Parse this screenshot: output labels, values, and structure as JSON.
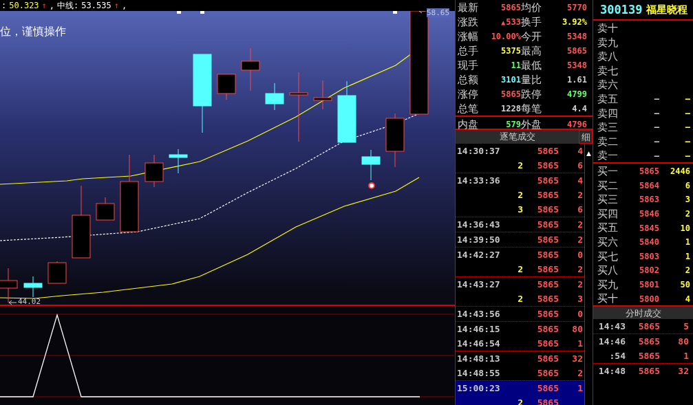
{
  "indicators": [
    {
      "label": ":",
      "value": "50.323",
      "arrow": "↑",
      "separator": ",",
      "color": "#ffff33"
    },
    {
      "label": "中线:",
      "value": "53.535",
      "arrow": "↑",
      "separator": ",",
      "color": "#ffffff"
    }
  ],
  "chart": {
    "banner": "位，谨慎操作",
    "high_label": "58.65",
    "low_label": "44.02"
  },
  "quote": [
    {
      "left": {
        "label": "最新",
        "value": "5865",
        "color": "#ff5555"
      },
      "right": {
        "label": "均价",
        "value": "5770",
        "color": "#ff5555"
      }
    },
    {
      "left": {
        "label": "涨跌",
        "icon": "▲",
        "value": "533",
        "color": "#ff5555"
      },
      "right": {
        "label": "换手",
        "value": "3.92%",
        "color": "#ffff33"
      }
    },
    {
      "left": {
        "label": "涨幅",
        "value": "10.00%",
        "color": "#ff5555"
      },
      "right": {
        "label": "今开",
        "value": "5348",
        "color": "#ff5555"
      }
    },
    {
      "left": {
        "label": "总手",
        "value": "5375",
        "color": "#ffff33"
      },
      "right": {
        "label": "最高",
        "value": "5865",
        "color": "#ff5555"
      }
    },
    {
      "left": {
        "label": "现手",
        "value": "11",
        "color": "#66ff66"
      },
      "right": {
        "label": "最低",
        "value": "5348",
        "color": "#ff5555"
      }
    },
    {
      "left": {
        "label": "总额",
        "value": "3101",
        "color": "#66ffff"
      },
      "right": {
        "label": "量比",
        "value": "1.61",
        "color": "#d0d0d0"
      }
    },
    {
      "left": {
        "label": "涨停",
        "value": "5865",
        "color": "#ff5555"
      },
      "right": {
        "label": "跌停",
        "value": "4799",
        "color": "#66ff66"
      }
    },
    {
      "left": {
        "label": "总笔",
        "value": "1228",
        "color": "#d0d0d0"
      },
      "right": {
        "label": "每笔",
        "value": "4.4",
        "color": "#d0d0d0"
      }
    }
  ],
  "volume_split": {
    "left": {
      "label": "内盘",
      "value": "579",
      "color": "#66ff66"
    },
    "right": {
      "label": "外盘",
      "value": "4796",
      "color": "#ff5555"
    }
  },
  "ticks": {
    "title": "逐笔成交",
    "detail_button": "细",
    "scroll_up": "▲",
    "groups": [
      {
        "selected": false,
        "rows": [
          {
            "time": "14:30:37",
            "price": "5865",
            "volume": "4"
          },
          {
            "count": "2",
            "price": "5865",
            "volume": "6"
          }
        ]
      },
      {
        "selected": false,
        "rows": [
          {
            "time": "14:33:36",
            "price": "5865",
            "volume": "4"
          },
          {
            "count": "2",
            "price": "5865",
            "volume": "2"
          },
          {
            "count": "3",
            "price": "5865",
            "volume": "6"
          }
        ]
      },
      {
        "selected": false,
        "rows": [
          {
            "time": "14:36:43",
            "price": "5865",
            "volume": "2"
          }
        ]
      },
      {
        "selected": false,
        "rows": [
          {
            "time": "14:39:50",
            "price": "5865",
            "volume": "2"
          }
        ]
      },
      {
        "selected": false,
        "rows": [
          {
            "time": "14:42:27",
            "price": "5865",
            "volume": "0"
          },
          {
            "count": "2",
            "price": "5865",
            "volume": "2"
          }
        ]
      },
      {
        "selected": false,
        "rows": [
          {
            "time": "14:43:27",
            "price": "5865",
            "volume": "2"
          },
          {
            "count": "2",
            "price": "5865",
            "volume": "3"
          }
        ]
      },
      {
        "selected": false,
        "rows": [
          {
            "time": "14:43:56",
            "price": "5865",
            "volume": "0"
          }
        ]
      },
      {
        "selected": false,
        "rows": [
          {
            "time": "14:46:15",
            "price": "5865",
            "volume": "80"
          },
          {
            "time": "14:46:54",
            "price": "5865",
            "volume": "1"
          }
        ]
      },
      {
        "selected": false,
        "rows": [
          {
            "time": "14:48:13",
            "price": "5865",
            "volume": "32"
          },
          {
            "time": "14:48:55",
            "price": "5865",
            "volume": "2"
          }
        ]
      },
      {
        "selected": true,
        "rows": [
          {
            "time": "15:00:23",
            "price": "5865",
            "volume": "1"
          },
          {
            "count": "2",
            "price": "5865"
          }
        ]
      }
    ]
  },
  "stock": {
    "code": "300139",
    "name": "福星晓程"
  },
  "asks": [
    {
      "label": "卖十"
    },
    {
      "label": "卖九"
    },
    {
      "label": "卖八"
    },
    {
      "label": "卖七"
    },
    {
      "label": "卖六"
    },
    {
      "label": "卖五",
      "price": "–",
      "volume": "–"
    },
    {
      "label": "卖四",
      "price": "–",
      "volume": "–"
    },
    {
      "label": "卖三",
      "price": "–",
      "volume": "–"
    },
    {
      "label": "卖二",
      "price": "–",
      "volume": "–"
    },
    {
      "label": "卖一",
      "price": "–",
      "volume": "–"
    }
  ],
  "bids": [
    {
      "label": "买一",
      "price": "5865",
      "volume": "2446"
    },
    {
      "label": "买二",
      "price": "5864",
      "volume": "6"
    },
    {
      "label": "买三",
      "price": "5863",
      "volume": "3"
    },
    {
      "label": "买四",
      "price": "5846",
      "volume": "2"
    },
    {
      "label": "买五",
      "price": "5845",
      "volume": "10"
    },
    {
      "label": "买六",
      "price": "5840",
      "volume": "1"
    },
    {
      "label": "买七",
      "price": "5803",
      "volume": "1"
    },
    {
      "label": "买八",
      "price": "5802",
      "volume": "2"
    },
    {
      "label": "买九",
      "price": "5801",
      "volume": "50"
    },
    {
      "label": "买十",
      "price": "5800",
      "volume": "4"
    }
  ],
  "minute_trades": {
    "title": "分时成交",
    "groups": [
      {
        "rows": [
          {
            "time": "14:43",
            "price": "5865",
            "volume": "5"
          }
        ]
      },
      {
        "rows": [
          {
            "time": "14:46",
            "price": "5865",
            "volume": "80"
          },
          {
            "time": ":54",
            "price": "5865",
            "volume": "1"
          }
        ]
      },
      {
        "rows": [
          {
            "time": "14:48",
            "price": "5865",
            "volume": "32"
          }
        ]
      }
    ]
  }
}
